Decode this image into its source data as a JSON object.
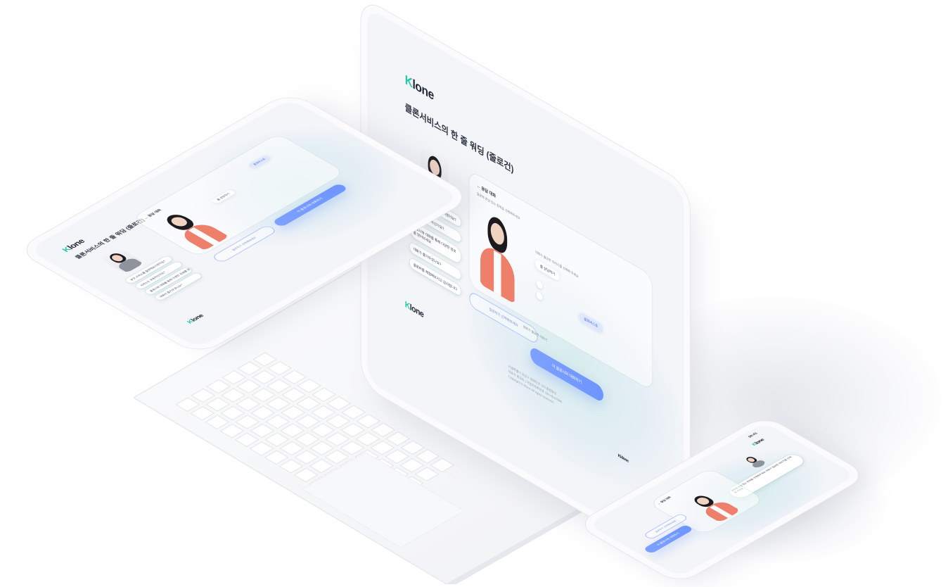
{
  "brand": {
    "name_k": "K",
    "name_rest": "lone",
    "sub": "Klone"
  },
  "page_title": "클론서비스의 한 줄 워딩 (줄로건)",
  "panel": {
    "back_label": "응답 대화",
    "user_message": "질문에 관심 있는 항목을 선택해주세요",
    "answer_hint": "대화가 필요한 이야기를 선택해 주세요",
    "answer_pill": "를 상담하기",
    "tag_pill": "클로버스토",
    "send_label": "질문하기 선택해보세요",
    "secondary_label": "대화가 필요한 이야기",
    "cta_label": "이 클로너와 대화하기",
    "icon_up": "plus-icon",
    "icon_down": "minus-icon"
  },
  "chips": [
    "무엇 서비스를 질문해보시겠어요?",
    "서비스는 유용하신가요?",
    "클로너와 대화를 통해 다양한 정보를 얻어보세요",
    "대화가 즐거우셨나요?",
    "클로버를 체험해보시고 감사합니다"
  ],
  "phone": {
    "time": "09:41",
    "chip_1": "질문에 관심 있는 항목을 선택해주세요 대화가 필요한 이야기를 선택해 주세요",
    "send_label": "질문하기 선택해보세요",
    "cta_label": "이 클로너와 대화하기"
  },
  "footer": {
    "brand": "Kklone",
    "lines": [
      "서울특별시 강남구 테헤란로 123 클론빌딩",
      "대표자 홍길동 | 사업자등록번호 123-45-67890",
      "Copyright © Klone All rights reserved."
    ]
  },
  "colors": {
    "accent": "#6e95ff",
    "brand_green": "#23c9a8",
    "coral": "#ee7f6b"
  }
}
